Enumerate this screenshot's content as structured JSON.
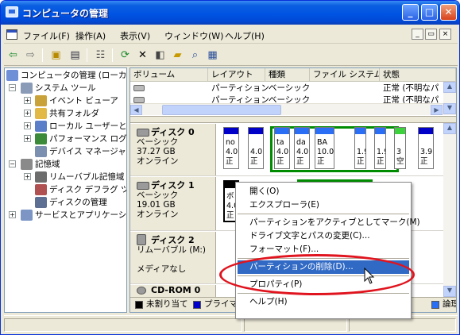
{
  "window": {
    "title": "コンピュータの管理",
    "min": "_",
    "max": "□",
    "close": "✕"
  },
  "menubar": {
    "items": [
      "ファイル(F)",
      "操作(A)",
      "表示(V)",
      "ウィンドウ(W)",
      "ヘルプ(H)"
    ],
    "mdi_min": "_",
    "mdi_restore": "▭",
    "mdi_close": "×"
  },
  "tree": {
    "root": "コンピュータの管理 (ローカル)",
    "system_tools": "システム ツール",
    "event_viewer": "イベント ビューア",
    "shared_folders": "共有フォルダ",
    "local_users": "ローカル ユーザーと",
    "performance": "パフォーマンス ログと",
    "device_manager": "デバイス マネージャ",
    "storage": "記憶域",
    "removable": "リムーバブル記憶域",
    "defrag": "ディスク デフラグ ツー",
    "disk_mgmt": "ディスクの管理",
    "services": "サービスとアプリケーション"
  },
  "list": {
    "headers": [
      "ボリューム",
      "レイアウト",
      "種類",
      "ファイル システム",
      "状態"
    ],
    "rows": [
      {
        "layout": "パーティション",
        "type": "ベーシック",
        "status": "正常 (不明なパ"
      },
      {
        "layout": "パーティション",
        "type": "ベーシック",
        "status": "正常 (不明なパ"
      }
    ]
  },
  "disks": [
    {
      "name": "ディスク 0",
      "type": "ベーシック",
      "size": "37.27 GB",
      "state": "オンライン",
      "parts": [
        {
          "l1": "no",
          "l2": "4.0",
          "l3": "正"
        },
        {
          "l1": "",
          "l2": "4.0",
          "l3": "正"
        },
        {
          "l1": "ta",
          "l2": "4.0",
          "l3": "正"
        },
        {
          "l1": "da",
          "l2": "4.0",
          "l3": "正"
        },
        {
          "l1": "BA",
          "l2": "10.0",
          "l3": "正"
        },
        {
          "l1": "",
          "l2": "1.9",
          "l3": "正"
        },
        {
          "l1": "",
          "l2": "1.9",
          "l3": "正"
        },
        {
          "l1": "",
          "l2": "3",
          "l3": "空"
        },
        {
          "l1": "",
          "l2": "3.9",
          "l3": "正"
        }
      ]
    },
    {
      "name": "ディスク 1",
      "type": "ベーシック",
      "size": "19.01 GB",
      "state": "オンライン",
      "parts": [
        {
          "l1": "ボ",
          "l2": "4.0",
          "l3": "正"
        }
      ]
    },
    {
      "name": "ディスク 2",
      "type": "リムーバブル (M:)",
      "size": "",
      "state": "メディアなし"
    },
    {
      "name": "CD-ROM 0"
    }
  ],
  "legend": [
    "未割り当て",
    "プライマリ",
    "論理"
  ],
  "colors": {
    "primary": "#0000c8",
    "unallocated": "#000000",
    "logical": "#2a6ef5",
    "selection": "#008c00",
    "accent_highlight": "#316ac5",
    "annotation": "#e0141e"
  },
  "context_menu": {
    "items": [
      {
        "label": "開く(O)"
      },
      {
        "label": "エクスプローラ(E)"
      },
      {
        "sep": true
      },
      {
        "label": "パーティションをアクティブとしてマーク(M)"
      },
      {
        "label": "ドライブ文字とパスの変更(C)..."
      },
      {
        "label": "フォーマット(F)..."
      },
      {
        "sep": true
      },
      {
        "label": "パーティションの削除(D)...",
        "highlighted": true
      },
      {
        "sep": true
      },
      {
        "label": "プロパティ(P)"
      },
      {
        "sep": true
      },
      {
        "label": "ヘルプ(H)"
      }
    ]
  }
}
